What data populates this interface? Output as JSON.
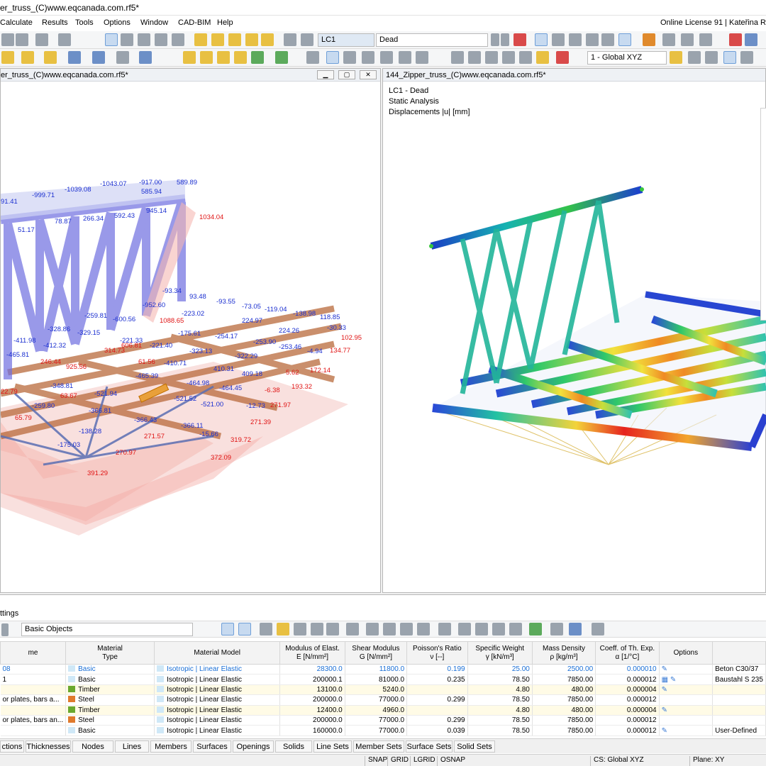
{
  "window": {
    "title": "er_truss_(C)www.eqcanada.com.rf5*",
    "license": "Online License 91 | Kateřina R"
  },
  "menu": [
    "Calculate",
    "Results",
    "Tools",
    "Options",
    "Window",
    "CAD-BIM",
    "Help"
  ],
  "toolbar": {
    "load_case_code": "LC1",
    "load_case_name": "Dead",
    "coord_system": "1 - Global XYZ",
    "view_label": "x.xx"
  },
  "left_view": {
    "title": "er_truss_(C)www.eqcanada.com.rf5*",
    "labels_blue": [
      {
        "t": "-1043.07"
      },
      {
        "t": "-917.00"
      },
      {
        "t": "589.89"
      },
      {
        "t": "-999.71"
      },
      {
        "t": "-1039.08"
      },
      {
        "t": "585.94"
      },
      {
        "t": "91.41"
      },
      {
        "t": "78.87"
      },
      {
        "t": "266.34"
      },
      {
        "t": "592.43"
      },
      {
        "t": "945.14"
      },
      {
        "t": "51.17"
      },
      {
        "t": "-93.34"
      },
      {
        "t": "-952.60"
      },
      {
        "t": "93.48"
      },
      {
        "t": "-93.55"
      },
      {
        "t": "-73.05"
      },
      {
        "t": "-119.04"
      },
      {
        "t": "-138.98"
      },
      {
        "t": "118.85"
      },
      {
        "t": "-259.81"
      },
      {
        "t": "-600.56"
      },
      {
        "t": "-223.02"
      },
      {
        "t": "-328.86"
      },
      {
        "t": "-329.15"
      },
      {
        "t": "224.97"
      },
      {
        "t": "224.26"
      },
      {
        "t": "-30.33"
      },
      {
        "t": "-411.98"
      },
      {
        "t": "-412.32"
      },
      {
        "t": "-221.33"
      },
      {
        "t": "-221.40"
      },
      {
        "t": "-175.61"
      },
      {
        "t": "-254.17"
      },
      {
        "t": "-253.90"
      },
      {
        "t": "-253.46"
      },
      {
        "t": "-4.94"
      },
      {
        "t": "-465.81"
      },
      {
        "t": "-323.13"
      },
      {
        "t": "-322.29"
      },
      {
        "t": "-410.71"
      },
      {
        "t": "410.31"
      },
      {
        "t": "409.18"
      },
      {
        "t": "-465.39"
      },
      {
        "t": "-464.98"
      },
      {
        "t": "-464.45"
      },
      {
        "t": "-348.81"
      },
      {
        "t": "-521.94"
      },
      {
        "t": "-521.52"
      },
      {
        "t": "-521.00"
      },
      {
        "t": "-259.80"
      },
      {
        "t": "-366.81"
      },
      {
        "t": "-366.43"
      },
      {
        "t": "-366.11"
      },
      {
        "t": "-138.28"
      },
      {
        "t": "-175.03"
      },
      {
        "t": "-15.66"
      },
      {
        "t": "-12.73"
      }
    ],
    "labels_red": [
      {
        "t": "1034.04"
      },
      {
        "t": "1088.65"
      },
      {
        "t": "102.95"
      },
      {
        "t": "134.77"
      },
      {
        "t": "172.14"
      },
      {
        "t": "193.32"
      },
      {
        "t": "271.97"
      },
      {
        "t": "271.39"
      },
      {
        "t": "319.72"
      },
      {
        "t": "372.09"
      },
      {
        "t": "270.97"
      },
      {
        "t": "391.29"
      },
      {
        "t": "271.57"
      },
      {
        "t": "65.79"
      },
      {
        "t": "63.67"
      },
      {
        "t": "61.56"
      },
      {
        "t": "606.81"
      },
      {
        "t": "925.56"
      },
      {
        "t": "246.44"
      },
      {
        "t": "314.73"
      },
      {
        "t": "22.79"
      },
      {
        "t": "5.62"
      },
      {
        "t": "-6.38"
      }
    ]
  },
  "right_view": {
    "title": "144_Zipper_truss_(C)www.eqcanada.com.rf5*",
    "info_line1": "LC1 - Dead",
    "info_line2": "Static Analysis",
    "info_line3": "Displacements |u| [mm]"
  },
  "bottom_panel": {
    "title": "ttings",
    "filter": "Basic Objects",
    "columns": [
      {
        "l1": "me",
        "l2": ""
      },
      {
        "l1": "Material",
        "l2": "Type"
      },
      {
        "l1": "",
        "l2": "Material Model"
      },
      {
        "l1": "Modulus of Elast.",
        "l2": "E [N/mm²]"
      },
      {
        "l1": "Shear Modulus",
        "l2": "G [N/mm²]"
      },
      {
        "l1": "Poisson's Ratio",
        "l2": "ν [--]"
      },
      {
        "l1": "Specific Weight",
        "l2": "γ [kN/m³]"
      },
      {
        "l1": "Mass Density",
        "l2": "ρ [kg/m³]"
      },
      {
        "l1": "Coeff. of Th. Exp.",
        "l2": "α [1/°C]"
      },
      {
        "l1": "",
        "l2": "Options"
      },
      {
        "l1": "",
        "l2": ""
      }
    ],
    "rows": [
      {
        "name": "08",
        "type": "Basic",
        "type_color": "#cfe8f7",
        "model": "Isotropic | Linear Elastic",
        "E": "28300.0",
        "G": "11800.0",
        "nu": "0.199",
        "gamma": "25.00",
        "rho": "2500.00",
        "alpha": "0.000010",
        "options": "✎",
        "extra": "Beton C30/37"
      },
      {
        "name": "1",
        "type": "Basic",
        "type_color": "#cfe8f7",
        "model": "Isotropic | Linear Elastic",
        "E": "200000.1",
        "G": "81000.0",
        "nu": "0.235",
        "gamma": "78.50",
        "rho": "7850.00",
        "alpha": "0.000012",
        "options": "▦ ✎",
        "extra": "Baustahl S 235"
      },
      {
        "name": "",
        "type": "Timber",
        "type_color": "#6aa82e",
        "model": "Isotropic | Linear Elastic",
        "E": "13100.0",
        "G": "5240.0",
        "nu": "",
        "gamma": "4.80",
        "rho": "480.00",
        "alpha": "0.000004",
        "options": "✎",
        "extra": ""
      },
      {
        "name": "or plates, bars a...",
        "type": "Steel",
        "type_color": "#e07a2c",
        "model": "Isotropic | Linear Elastic",
        "E": "200000.0",
        "G": "77000.0",
        "nu": "0.299",
        "gamma": "78.50",
        "rho": "7850.00",
        "alpha": "0.000012",
        "options": "",
        "extra": ""
      },
      {
        "name": "",
        "type": "Timber",
        "type_color": "#6aa82e",
        "model": "Isotropic | Linear Elastic",
        "E": "12400.0",
        "G": "4960.0",
        "nu": "",
        "gamma": "4.80",
        "rho": "480.00",
        "alpha": "0.000004",
        "options": "✎",
        "extra": ""
      },
      {
        "name": "or plates, bars an...",
        "type": "Steel",
        "type_color": "#e07a2c",
        "model": "Isotropic | Linear Elastic",
        "E": "200000.0",
        "G": "77000.0",
        "nu": "0.299",
        "gamma": "78.50",
        "rho": "7850.00",
        "alpha": "0.000012",
        "options": "",
        "extra": ""
      },
      {
        "name": "",
        "type": "Basic",
        "type_color": "#cfe8f7",
        "model": "Isotropic | Linear Elastic",
        "E": "160000.0",
        "G": "77000.0",
        "nu": "0.039",
        "gamma": "78.50",
        "rho": "7850.00",
        "alpha": "0.000012",
        "options": "✎",
        "extra": "User-Defined"
      }
    ],
    "tabs": [
      "ctions",
      "Thicknesses",
      "Nodes",
      "Lines",
      "Members",
      "Surfaces",
      "Openings",
      "Solids",
      "Line Sets",
      "Member Sets",
      "Surface Sets",
      "Solid Sets"
    ]
  },
  "status_bar": {
    "items": [
      "SNAP",
      "GRID",
      "LGRID",
      "OSNAP"
    ],
    "cs": "CS: Global XYZ",
    "plane": "Plane: XY"
  }
}
